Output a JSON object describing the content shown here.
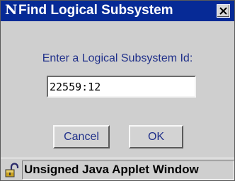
{
  "window": {
    "title": "Find Logical Subsystem",
    "logo_icon": "netscape-n-icon",
    "close_icon": "close-icon"
  },
  "dialog": {
    "prompt": "Enter a Logical Subsystem Id:",
    "input_value": "22559:12",
    "cancel_label": "Cancel",
    "ok_label": "OK"
  },
  "statusbar": {
    "lock_icon": "unlocked-padlock-icon",
    "text": "Unsigned Java Applet Window"
  },
  "colors": {
    "titlebar": "#062a96",
    "dialog_background": "#cfcfcf",
    "label_text": "#20308a"
  }
}
